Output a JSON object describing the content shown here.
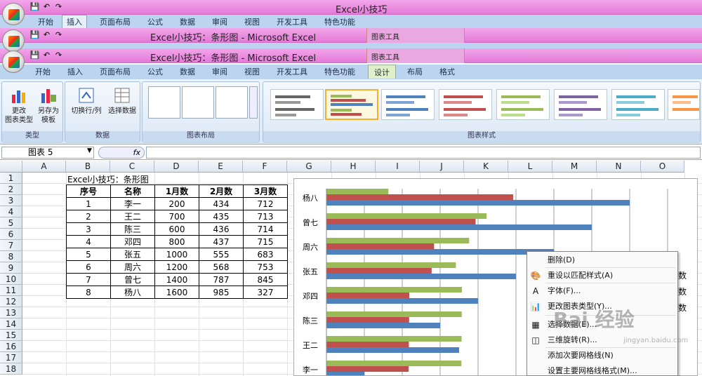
{
  "windows": [
    {
      "title": "Excel小技巧",
      "context": ""
    },
    {
      "title": "Excel小技巧：条形图 - Microsoft Excel",
      "context": "图表工具"
    },
    {
      "title": "Excel小技巧：条形图 - Microsoft Excel",
      "context": "图表工具"
    }
  ],
  "tabs_back": [
    "开始",
    "插入",
    "页面布局",
    "公式",
    "数据",
    "审阅",
    "视图",
    "开发工具",
    "特色功能"
  ],
  "tabs_front": [
    "开始",
    "插入",
    "页面布局",
    "公式",
    "数据",
    "审阅",
    "视图",
    "开发工具",
    "特色功能",
    "设计",
    "布局",
    "格式"
  ],
  "ribbon": {
    "change_type": "更改\n图表类型",
    "save_template": "另存为\n模板",
    "switch_row_col": "切换行/列",
    "select_data": "选择数据",
    "group_type": "类型",
    "group_data": "数据",
    "group_layout": "图表布局",
    "group_style": "图表样式"
  },
  "formula_bar": {
    "name_box": "图表 5",
    "fx": "fx"
  },
  "columns": [
    "A",
    "B",
    "C",
    "D",
    "E",
    "F",
    "G",
    "H",
    "I",
    "J",
    "K",
    "L",
    "M",
    "N",
    "O"
  ],
  "rows": [
    "1",
    "2",
    "3",
    "4",
    "5",
    "6",
    "7",
    "8",
    "9",
    "10",
    "11",
    "12",
    "13",
    "14",
    "15",
    "16",
    "17",
    "18"
  ],
  "sheet": {
    "title": "Excel小技巧：条形图",
    "headers": [
      "序号",
      "名称",
      "1月数",
      "2月数",
      "3月数"
    ],
    "data": [
      [
        "1",
        "李一",
        "200",
        "434",
        "712"
      ],
      [
        "2",
        "王二",
        "700",
        "435",
        "713"
      ],
      [
        "3",
        "陈三",
        "600",
        "436",
        "714"
      ],
      [
        "4",
        "邓四",
        "800",
        "437",
        "715"
      ],
      [
        "5",
        "张五",
        "1000",
        "555",
        "683"
      ],
      [
        "6",
        "周六",
        "1200",
        "568",
        "753"
      ],
      [
        "7",
        "曾七",
        "1400",
        "787",
        "845"
      ],
      [
        "8",
        "杨八",
        "1600",
        "985",
        "327"
      ]
    ]
  },
  "chart_data": {
    "type": "bar",
    "orientation": "horizontal",
    "categories": [
      "杨八",
      "曾七",
      "周六",
      "张五",
      "邓四",
      "陈三",
      "王二",
      "李一"
    ],
    "series": [
      {
        "name": "1月数",
        "color": "#4f81bd",
        "values": [
          1600,
          1400,
          1200,
          1000,
          800,
          600,
          700,
          200
        ]
      },
      {
        "name": "2月数",
        "color": "#c0504d",
        "values": [
          985,
          787,
          568,
          555,
          437,
          436,
          435,
          434
        ]
      },
      {
        "name": "3月数",
        "color": "#9bbb59",
        "values": [
          327,
          845,
          753,
          683,
          715,
          714,
          713,
          712
        ]
      }
    ],
    "xlim": [
      0,
      1800
    ],
    "grid": true
  },
  "context_menu": [
    {
      "label": "删除(D)",
      "icon": ""
    },
    {
      "label": "重设以匹配样式(A)",
      "icon": "reset-icon"
    },
    {
      "label": "字体(F)...",
      "icon": "font-icon"
    },
    {
      "label": "更改图表类型(Y)...",
      "icon": "chart-type-icon"
    },
    {
      "label": "选择数据(E)...",
      "icon": "select-data-icon"
    },
    {
      "label": "三维旋转(R)...",
      "icon": "rotate-3d-icon"
    },
    {
      "label": "添加次要网格线(N)",
      "icon": ""
    },
    {
      "label": "设置主要网格线格式(M)...",
      "icon": ""
    }
  ],
  "legend_partial": [
    "数",
    "数",
    "数"
  ],
  "watermark": {
    "brand": "Bai 经验",
    "sub": "jingyan.baidu.com"
  }
}
